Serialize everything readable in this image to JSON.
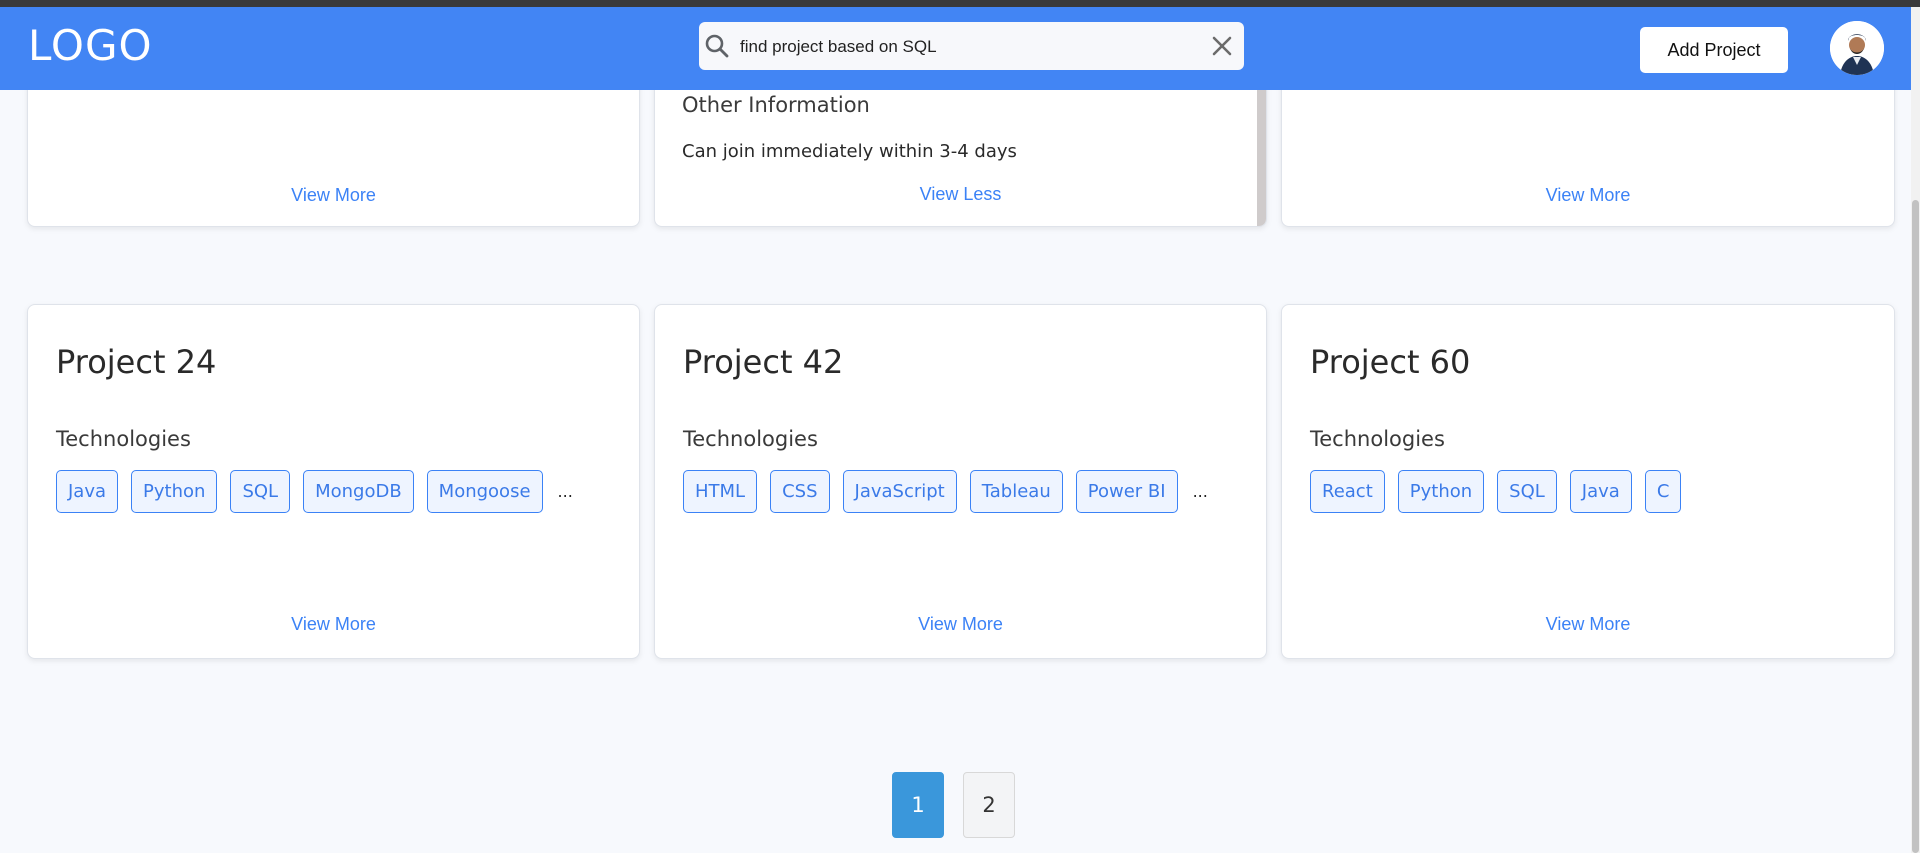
{
  "header": {
    "logo": "LOGO",
    "search_value": "find project based on SQL",
    "add_project_label": "Add Project",
    "accent_color": "#4285f4"
  },
  "top_row": {
    "left": {
      "link": "View More"
    },
    "middle": {
      "other_info_title": "Other Information",
      "other_info_text": "Can join immediately within 3-4 days",
      "link": "View Less"
    },
    "right": {
      "link": "View More"
    }
  },
  "projects": [
    {
      "title": "Project 24",
      "tech_label": "Technologies",
      "tags": [
        "Java",
        "Python",
        "SQL",
        "MongoDB",
        "Mongoose"
      ],
      "more": "...",
      "link": "View More"
    },
    {
      "title": "Project 42",
      "tech_label": "Technologies",
      "tags": [
        "HTML",
        "CSS",
        "JavaScript",
        "Tableau",
        "Power BI"
      ],
      "more": "...",
      "link": "View More"
    },
    {
      "title": "Project 60",
      "tech_label": "Technologies",
      "tags": [
        "React",
        "Python",
        "SQL",
        "Java",
        "C"
      ],
      "more": "",
      "link": "View More"
    }
  ],
  "pagination": {
    "pages": [
      "1",
      "2"
    ],
    "current": "1"
  },
  "icons": {
    "search": "search-icon",
    "clear": "close-icon",
    "avatar": "avatar"
  }
}
